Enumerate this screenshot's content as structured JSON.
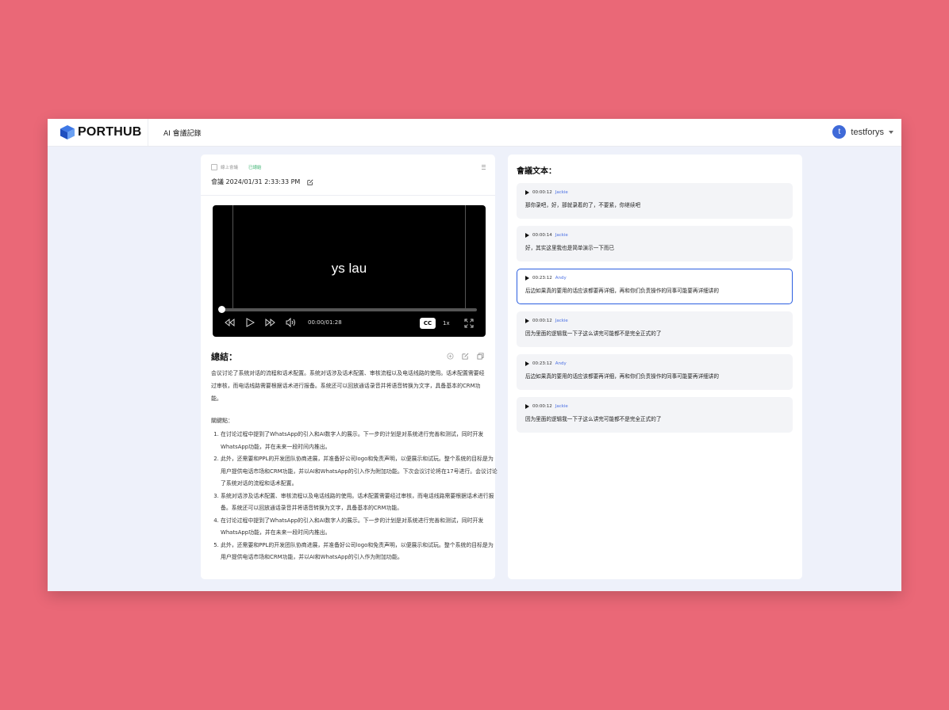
{
  "app": {
    "logo_text": "PORTHUB",
    "nav_title": "AI 會議記錄"
  },
  "user": {
    "avatar_initial": "t",
    "name": "testforys"
  },
  "meeting": {
    "type": "線上會議",
    "status": "已總結",
    "title": "會議 2024/01/31 2:33:33 PM"
  },
  "video": {
    "caption": "ys lau",
    "time": "00:00/01:28",
    "cc_label": "CC",
    "speed": "1x",
    "progress": 0
  },
  "summary": {
    "title": "總結：",
    "text": "会议讨论了系统对话的流程和话术配置。系统对话涉及话术配置、审核流程以及电话线路的使用。话术配置需要经过审核，而电话线路需要根据话术进行报备。系统还可以回放通话录音并将语音转换为文字，具备基本的CRM功能。",
    "key_points_title": "關鍵點：",
    "key_points": [
      "在讨论过程中提到了WhatsApp的引入和AI数字人的展示。下一步的计划是对系统进行完善和测试，同时开发WhatsApp功能，并在未来一段时间内推出。",
      "此外，还需要和PPL的开发团队协商进展，并准备好公司logo和免责声明，以便展示和试玩。整个系统的目标是为用户提供电话市场和CRM功能，并以AI和WhatsApp的引入作为附加功能。下次会议讨论将在17号进行。会议讨论了系统对话的流程和话术配置。",
      "系统对话涉及话术配置、审核流程以及电话线路的使用。话术配置需要经过审核，而电话线路需要根据话术进行报备。系统还可以回放通话录音并将语音转换为文字，具备基本的CRM功能。",
      "在讨论过程中提到了WhatsApp的引入和AI数字人的展示。下一步的计划是对系统进行完善和测试，同时开发WhatsApp功能，并在未来一段时间内推出。",
      "此外，还需要和PPL的开发团队协商进展，并准备好公司logo和免责声明，以便展示和试玩。整个系统的目标是为用户提供电话市场和CRM功能，并以AI和WhatsApp的引入作为附加功能。"
    ]
  },
  "transcript": {
    "title": "會議文本：",
    "entries": [
      {
        "time": "00:00:12",
        "speaker": "Jackie",
        "text": "那你录吧，好，那就录着的了，不要紧，你继续吧"
      },
      {
        "time": "00:00:14",
        "speaker": "Jackie",
        "text": "好，其实这里我也是简单演示一下而已"
      },
      {
        "time": "00:23:12",
        "speaker": "Andy",
        "text": "后边如果真的要用的话应该都要再详细，再和你们负责操作的同事可能要再详细讲的"
      },
      {
        "time": "00:00:12",
        "speaker": "Jackie",
        "text": "因为里面的逻辑我一下子这么讲完可能都不是完全正式的了"
      },
      {
        "time": "00:23:12",
        "speaker": "Andy",
        "text": "后边如果真的要用的话应该都要再详细，再和你们负责操作的同事可能要再详细讲的"
      },
      {
        "time": "00:00:12",
        "speaker": "Jackie",
        "text": "因为里面的逻辑我一下子这么讲完可能都不是完全正式的了"
      }
    ]
  }
}
